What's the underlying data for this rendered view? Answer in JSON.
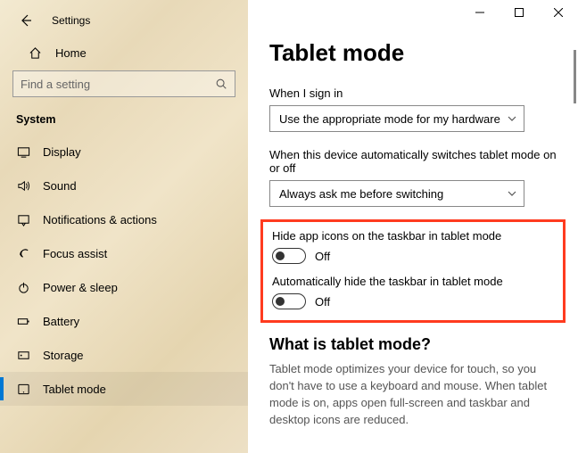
{
  "sidebar": {
    "title": "Settings",
    "home": "Home",
    "search_placeholder": "Find a setting",
    "section_label": "System",
    "items": [
      {
        "label": "Display"
      },
      {
        "label": "Sound"
      },
      {
        "label": "Notifications & actions"
      },
      {
        "label": "Focus assist"
      },
      {
        "label": "Power & sleep"
      },
      {
        "label": "Battery"
      },
      {
        "label": "Storage"
      },
      {
        "label": "Tablet mode"
      }
    ]
  },
  "main": {
    "heading": "Tablet mode",
    "signin_label": "When I sign in",
    "signin_value": "Use the appropriate mode for my hardware",
    "switch_label": "When this device automatically switches tablet mode on or off",
    "switch_value": "Always ask me before switching",
    "toggle1_label": "Hide app icons on the taskbar in tablet mode",
    "toggle1_state": "Off",
    "toggle2_label": "Automatically hide the taskbar in tablet mode",
    "toggle2_state": "Off",
    "sub_heading": "What is tablet mode?",
    "description": "Tablet mode optimizes your device for touch, so you don't have to use a keyboard and mouse. When tablet mode is on, apps open full-screen and taskbar and desktop icons are reduced."
  }
}
